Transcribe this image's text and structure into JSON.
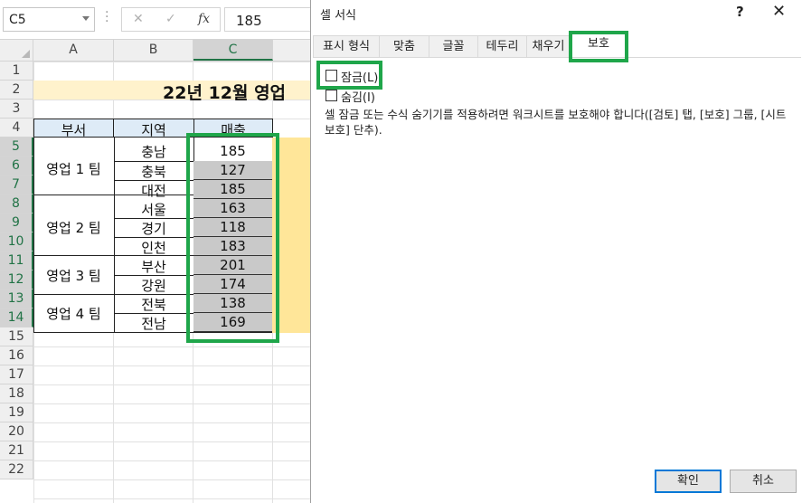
{
  "formula_bar": {
    "name_box": "C5",
    "cancel_icon": "✕",
    "enter_icon": "✓",
    "fx_icon": "fx",
    "formula_value": "185"
  },
  "columns": [
    "A",
    "B",
    "C"
  ],
  "rows": [
    "1",
    "2",
    "3",
    "4",
    "5",
    "6",
    "7",
    "8",
    "9",
    "10",
    "11",
    "12",
    "13",
    "14",
    "15",
    "16",
    "17",
    "18",
    "19",
    "20",
    "21",
    "22"
  ],
  "sheet": {
    "title": "22년 12월 영업",
    "headers": {
      "dept": "부서",
      "region": "지역",
      "sales": "매출"
    },
    "teams": [
      "영업 1 팀",
      "영업 2 팀",
      "영업 3 팀",
      "영업 4 팀"
    ],
    "regions": [
      "충남",
      "충북",
      "대전",
      "서울",
      "경기",
      "인천",
      "부산",
      "강원",
      "전북",
      "전남"
    ],
    "sales": [
      "185",
      "127",
      "185",
      "163",
      "118",
      "183",
      "201",
      "174",
      "138",
      "169"
    ]
  },
  "dialog": {
    "title": "셀 서식",
    "help": "?",
    "close": "✕",
    "tabs": [
      "표시 형식",
      "맞춤",
      "글꼴",
      "테두리",
      "채우기",
      "보호"
    ],
    "active_tab": "보호",
    "lock_label": "잠금(L)",
    "hidden_label": "숨김(I)",
    "description": "셀 잠금 또는 수식 숨기기를 적용하려면 워크시트를 보호해야 합니다([검토] 탭, [보호] 그룹, [시트 보호] 단추).",
    "ok": "확인",
    "cancel": "취소"
  },
  "colors": {
    "highlight": "#1fa64a",
    "excel_green": "#217346",
    "header_fill": "#deebf7",
    "title_fill": "#fff2cc"
  }
}
